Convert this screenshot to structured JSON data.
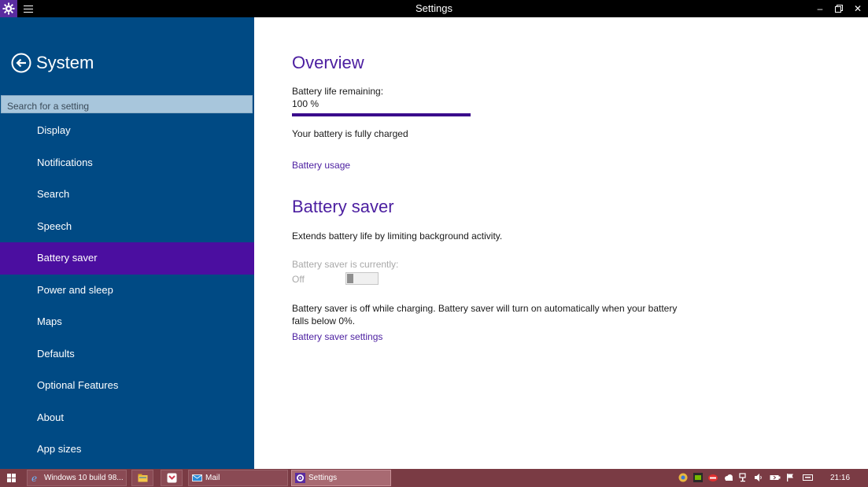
{
  "window": {
    "title": "Settings",
    "app_icon": "gear-icon",
    "menu_icon": "hamburger-icon"
  },
  "sidebar": {
    "title": "System",
    "back_icon": "back-arrow-icon",
    "search_placeholder": "Search for a setting",
    "items": [
      {
        "label": "Display",
        "active": false
      },
      {
        "label": "Notifications",
        "active": false
      },
      {
        "label": "Search",
        "active": false
      },
      {
        "label": "Speech",
        "active": false
      },
      {
        "label": "Battery saver",
        "active": true
      },
      {
        "label": "Power and sleep",
        "active": false
      },
      {
        "label": "Maps",
        "active": false
      },
      {
        "label": "Defaults",
        "active": false
      },
      {
        "label": "Optional Features",
        "active": false
      },
      {
        "label": "About",
        "active": false
      },
      {
        "label": "App sizes",
        "active": false
      }
    ]
  },
  "overview": {
    "heading": "Overview",
    "battery_label": "Battery life remaining:",
    "battery_value": "100 %",
    "battery_fraction": 1.0,
    "status": "Your battery is fully charged",
    "usage_link": "Battery usage"
  },
  "saver": {
    "heading": "Battery saver",
    "description": "Extends battery life by limiting background activity.",
    "currently_label": "Battery saver is currently:",
    "state": "Off",
    "note_line1": "Battery saver is off while charging. Battery saver will turn on automatically when your battery",
    "note_line2": "falls below 0%.",
    "settings_link": "Battery saver settings"
  },
  "taskbar": {
    "buttons": [
      {
        "label": "Windows 10 build 98...",
        "icon": "ie-icon"
      },
      {
        "label": "",
        "icon": "file-explorer-icon"
      },
      {
        "label": "",
        "icon": "pocket-icon"
      },
      {
        "label": "Mail",
        "icon": "mail-icon"
      },
      {
        "label": "Settings",
        "icon": "gear-icon"
      }
    ],
    "clock": "21:16"
  },
  "colors": {
    "accent": "#4b1ea0",
    "sidebar": "#004a84",
    "active_item": "#4b0ea0",
    "taskbar": "#7a3b44"
  }
}
